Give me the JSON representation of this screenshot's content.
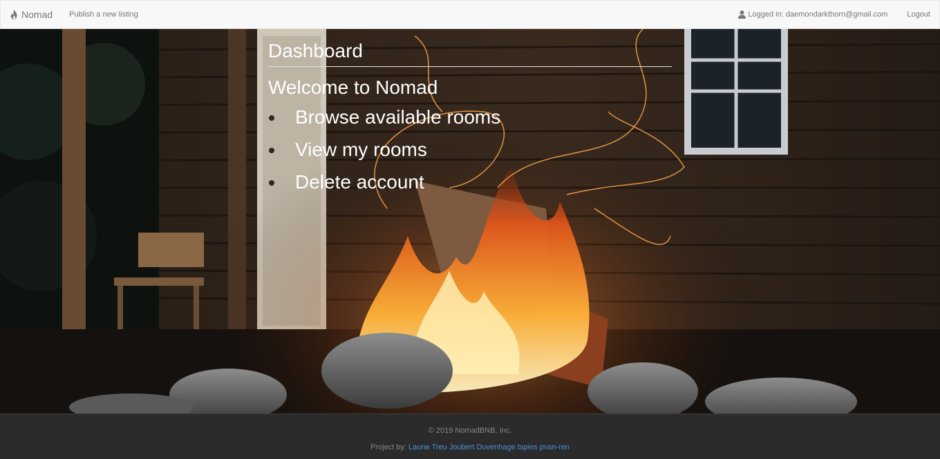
{
  "navbar": {
    "brand": "Nomad",
    "publish_link": "Publish a new listing",
    "logged_in_text": "Logged in: daemondarkthorn@gmail.com",
    "logout_link": "Logout",
    "brand_icon": "fire-icon",
    "user_icon": "user-icon"
  },
  "dashboard": {
    "title": "Dashboard",
    "welcome": "Welcome to Nomad",
    "menu": [
      {
        "label": "Browse available rooms"
      },
      {
        "label": "View my rooms"
      },
      {
        "label": "Delete account"
      }
    ]
  },
  "hero": {
    "background_scene": "campfire in front of wooden cabin"
  },
  "footer": {
    "copyright": "© 2019 NomadBNB, Inc.",
    "credits_prefix": "Project by:",
    "credits_names": "Laune Treu Joubert Duvenhage tspies pvan-ren"
  },
  "colors": {
    "navbar_bg": "#f8f8f8",
    "nav_text": "#777777",
    "footer_bg": "#2b2b2b",
    "footer_text": "#888888",
    "link_blue": "#4c8fd8",
    "content_text": "#ffffff"
  }
}
